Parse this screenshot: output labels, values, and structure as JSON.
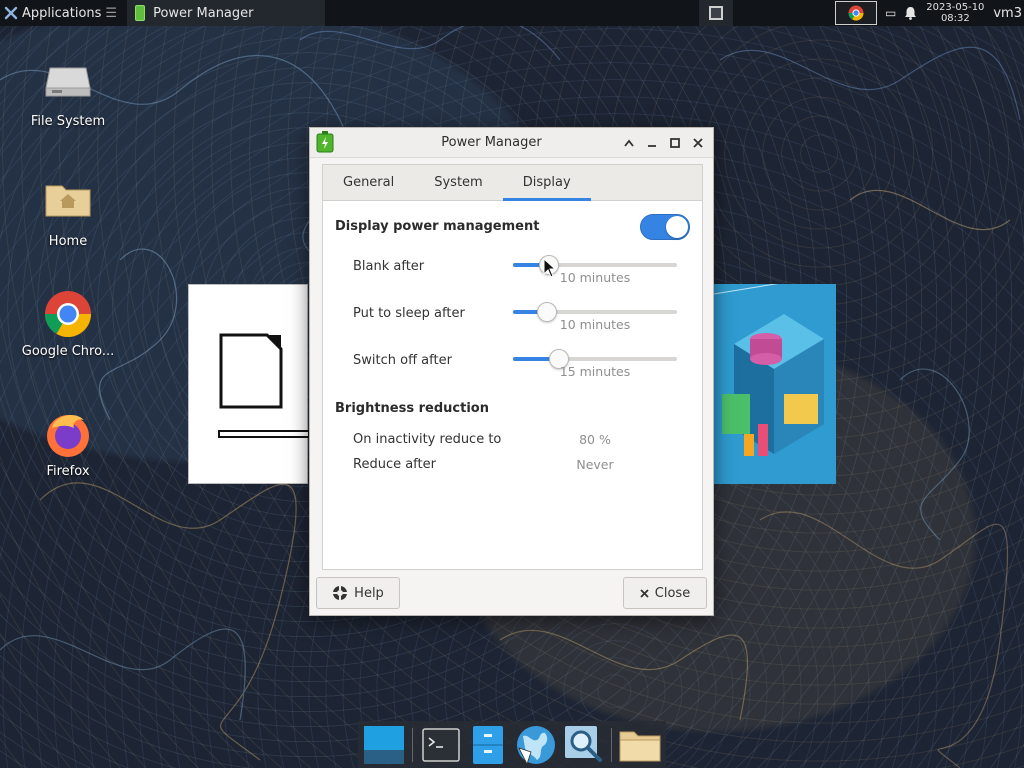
{
  "top_panel": {
    "applications_label": "Applications",
    "task_title": "Power Manager",
    "clock_date": "2023-05-10",
    "clock_time": "08:32",
    "user": "vm3"
  },
  "desktop": {
    "icons": [
      {
        "label": "File System"
      },
      {
        "label": "Home"
      },
      {
        "label": "Google Chro..."
      },
      {
        "label": "Firefox"
      }
    ]
  },
  "dialog": {
    "title": "Power Manager",
    "tabs": [
      "General",
      "System",
      "Display"
    ],
    "active_tab": "Display",
    "display_power_management": {
      "title": "Display power management",
      "enabled": true,
      "rows": [
        {
          "label": "Blank after",
          "value": "10 minutes",
          "level": 0.18
        },
        {
          "label": "Put to sleep after",
          "value": "10 minutes",
          "level": 0.17
        },
        {
          "label": "Switch off after",
          "value": "15 minutes",
          "level": 0.25
        }
      ]
    },
    "brightness_reduction": {
      "title": "Brightness reduction",
      "rows": [
        {
          "label": "On inactivity reduce to",
          "value": "80 %"
        },
        {
          "label": "Reduce after",
          "value": "Never"
        }
      ]
    },
    "help_label": "Help",
    "close_label": "Close"
  },
  "colors": {
    "accent": "#3584e4",
    "panel": "#111418"
  }
}
